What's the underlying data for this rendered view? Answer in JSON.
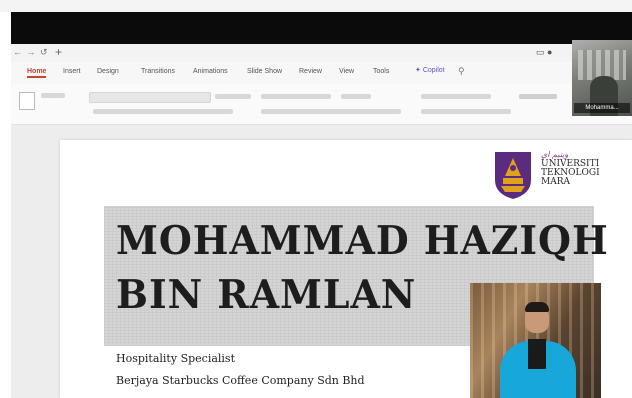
{
  "toolbar_nav": {
    "arrows": "← → ↺",
    "new_tab": "+"
  },
  "ribbon": {
    "tabs": [
      "Home",
      "Insert",
      "Design",
      "Transitions",
      "Animations",
      "Slide Show",
      "Review",
      "View",
      "Tools"
    ],
    "active_tab": "Home",
    "copilot_label": "Copilot",
    "search_icon": "search-icon"
  },
  "webcam": {
    "name_tag": "Mohamma..."
  },
  "slide": {
    "logo": {
      "jawi": "ويتيم اي",
      "lines": [
        "UNIVERSITI",
        "TEKNOLOGI",
        "MARA"
      ]
    },
    "name_line1": "MOHAMMAD HAZIQH",
    "name_line2": "BIN RAMLAN",
    "role": "Hospitality Specialist",
    "company": "Berjaya Starbucks Coffee Company Sdn Bhd"
  },
  "colors": {
    "accent": "#c5432b",
    "copilot": "#5a5ac8",
    "logo_purple": "#5b2b80",
    "logo_gold": "#e0a21a"
  }
}
